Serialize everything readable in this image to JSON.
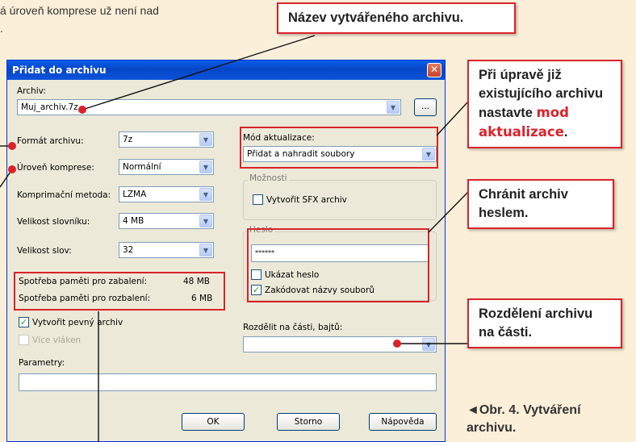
{
  "article": {
    "top_text_line1": "á úroveň komprese už není nad",
    "top_text_line2": ".",
    "caption": "◄Obr. 4. Vytváření archivu."
  },
  "callouts": {
    "archive_name": "Název vytvářeného archivu.",
    "update_mode_text": "Při úpravě již existujícího archivu nastavte",
    "update_mode_highlight": "mod aktualizace",
    "password": "Chránit archiv heslem.",
    "split": "Rozdělení archivu na části."
  },
  "dialog": {
    "title": "Přidat do archivu",
    "archive_label": "Archiv:",
    "archive_value": "Muj_archiv.7z",
    "browse_label": "...",
    "format_label": "Formát archivu:",
    "format_value": "7z",
    "level_label": "Úroveň komprese:",
    "level_value": "Normální",
    "method_label": "Komprimační metoda:",
    "method_value": "LZMA",
    "dict_label": "Velikost slovníku:",
    "dict_value": "4 MB",
    "word_label": "Velikost slov:",
    "word_value": "32",
    "mem_pack_label": "Spotřeba paměti pro zabalení:",
    "mem_pack_value": "48 MB",
    "mem_unpack_label": "Spotřeba paměti pro rozbalení:",
    "mem_unpack_value": "6 MB",
    "solid_label": "Vytvořit pevný archiv",
    "threads_label": "Více vláken",
    "params_label": "Parametry:",
    "update_label": "Mód aktualizace:",
    "update_value": "Přidat a nahradit soubory",
    "options_title": "Možnosti",
    "sfx_label": "Vytvořit SFX archiv",
    "password_title": "Heslo",
    "password_value": "******",
    "show_password_label": "Ukázat heslo",
    "encrypt_names_label": "Zakódovat názvy souborů",
    "split_label": "Rozdělit na části, bajtů:",
    "ok": "OK",
    "cancel": "Storno",
    "help": "Nápověda",
    "close": "✕",
    "check_mark": "✓",
    "arrow": "▼"
  },
  "colors": {
    "accent_red": "#d9232a",
    "background": "#fbefd9",
    "xp_blue": "#0646c9"
  }
}
